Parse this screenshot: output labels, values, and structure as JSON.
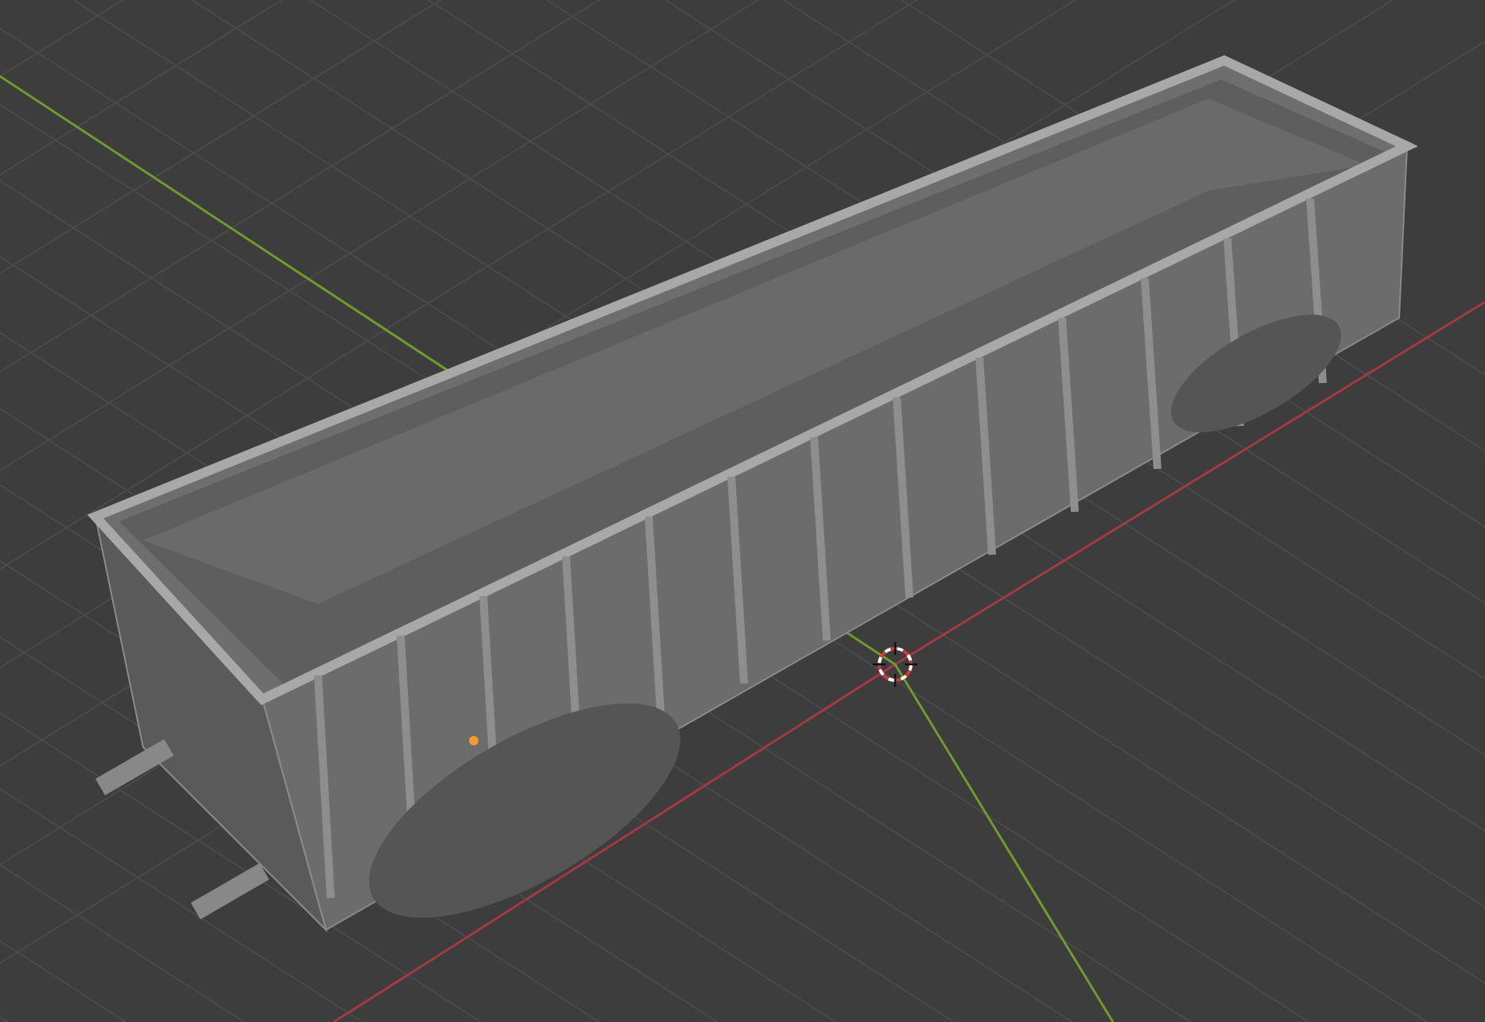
{
  "viewport": {
    "grid": true,
    "axes": [
      {
        "kind": "x",
        "color": "#a23a44"
      },
      {
        "kind": "y",
        "color": "#6f9a2c"
      }
    ],
    "origin_marker": true,
    "object_origin": true
  }
}
